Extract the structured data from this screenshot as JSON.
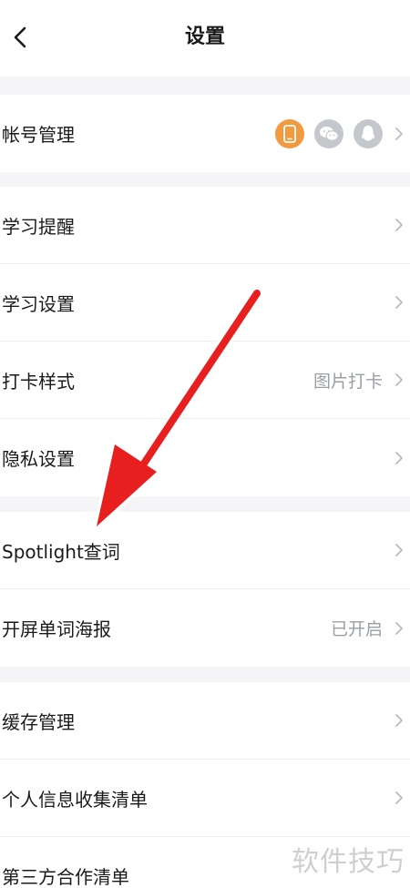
{
  "header": {
    "title": "设置"
  },
  "account": {
    "label": "帐号管理",
    "icons": [
      "phone-icon",
      "wechat-icon",
      "qq-icon"
    ],
    "colors": {
      "phone": "#f29a3f",
      "inactive": "#c4c7cc"
    }
  },
  "group2": {
    "items": [
      {
        "label": "学习提醒",
        "value": ""
      },
      {
        "label": "学习设置",
        "value": ""
      },
      {
        "label": "打卡样式",
        "value": "图片打卡"
      },
      {
        "label": "隐私设置",
        "value": ""
      }
    ]
  },
  "group3": {
    "items": [
      {
        "label": "Spotlight查词",
        "value": ""
      },
      {
        "label": "开屏单词海报",
        "value": "已开启"
      }
    ]
  },
  "group4": {
    "items": [
      {
        "label": "缓存管理",
        "value": ""
      },
      {
        "label": "个人信息收集清单",
        "value": ""
      },
      {
        "label": "第三方合作清单",
        "value": ""
      }
    ]
  },
  "watermark": "软件技巧",
  "colors": {
    "arrow": "#e81f1f",
    "background": "#f5f5f7",
    "secondary_text": "#9a9ea6"
  }
}
